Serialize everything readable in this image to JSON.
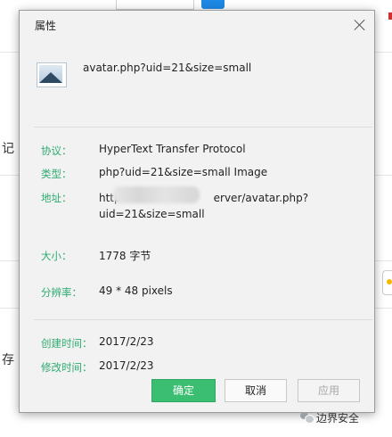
{
  "background": {
    "left_chars": [
      "记",
      "存"
    ]
  },
  "dialog": {
    "title": "属性",
    "file_name": "avatar.php?uid=21&size=small",
    "props": {
      "protocol_label": "协议：",
      "protocol_value": "HyperText Transfer Protocol",
      "type_label": "类型：",
      "type_value": "php?uid=21&size=small Image",
      "address_label": "地址：",
      "address_line1_start": "http",
      "address_line1_end": "erver/avatar.php?",
      "address_line2": "uid=21&size=small",
      "size_label": "大小：",
      "size_value": "1778 字节",
      "resolution_label": "分辨率：",
      "resolution_value": "49 * 48 pixels",
      "created_label": "创建时间：",
      "created_value": "2017/2/23",
      "modified_label": "修改时间：",
      "modified_value": "2017/2/23"
    },
    "buttons": {
      "ok": "确定",
      "cancel": "取消",
      "apply": "应用"
    }
  },
  "watermark": "边界安全",
  "colors": {
    "label": "#2eab6f",
    "ok_button": "#3bbd72"
  },
  "icons": {
    "file": "image-file-icon",
    "close": "close-icon"
  }
}
